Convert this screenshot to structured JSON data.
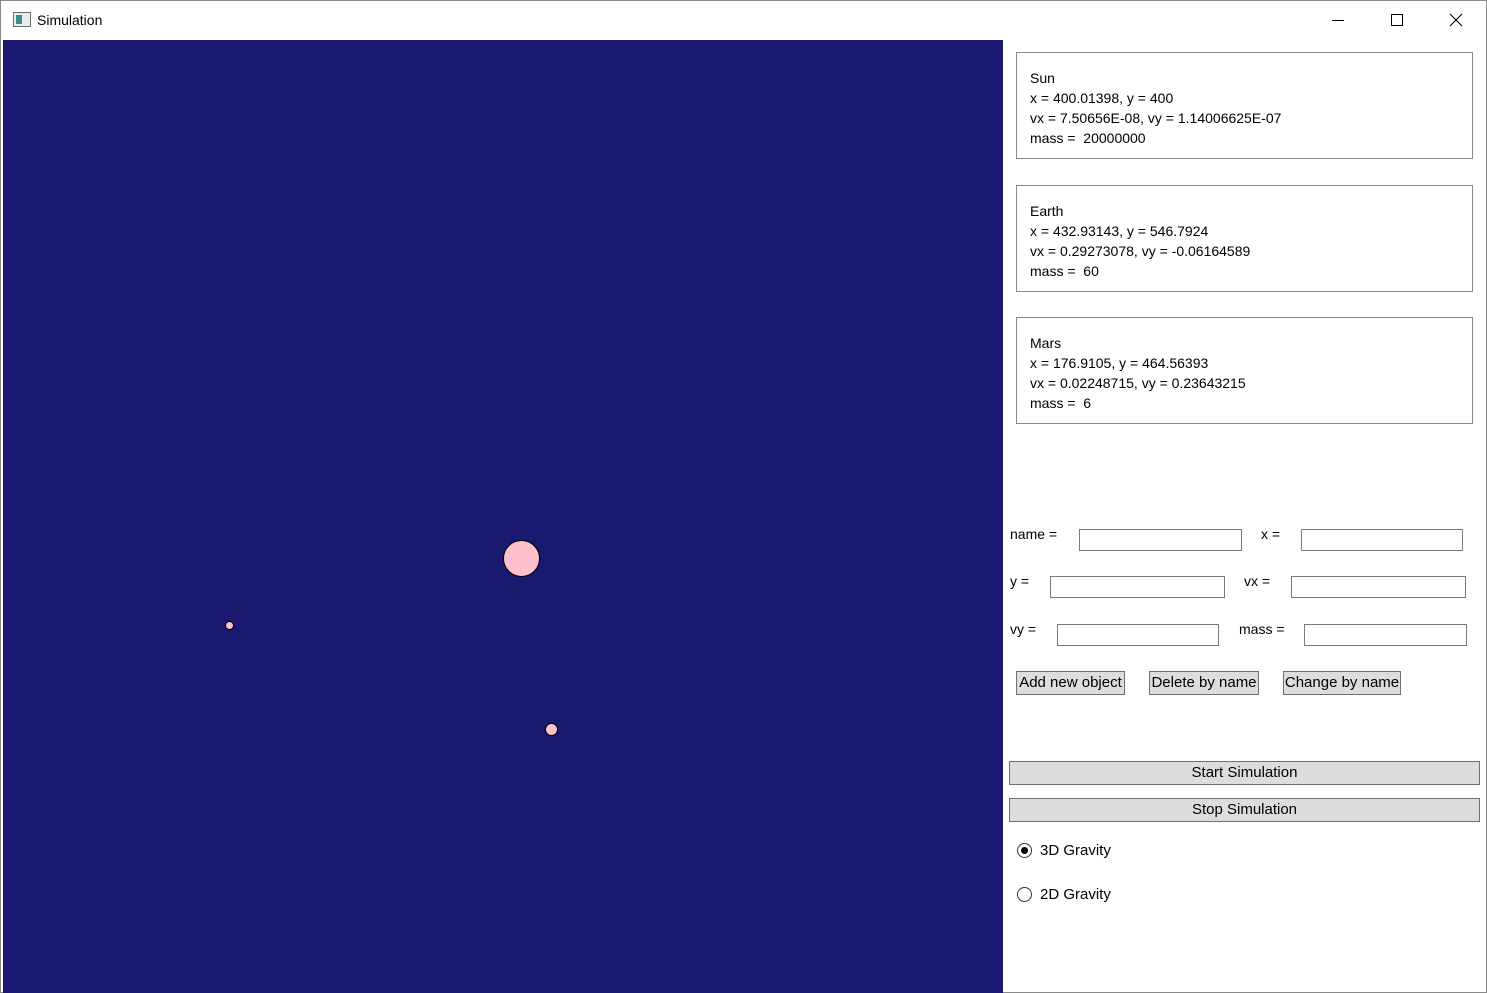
{
  "window": {
    "title": "Simulation"
  },
  "canvas": {
    "background": "#191970",
    "body_color": "#ffc0cb"
  },
  "bodies": [
    {
      "name": "Sun",
      "pos": "x = 400.01398, y = 400",
      "vel": "vx = 7.50656E-08, vy = 1.14006625E-07",
      "mass": "mass =  20000000"
    },
    {
      "name": "Earth",
      "pos": "x = 432.93143, y = 546.7924",
      "vel": "vx = 0.29273078, vy = -0.06164589",
      "mass": "mass =  60"
    },
    {
      "name": "Mars",
      "pos": "x = 176.9105, y = 464.56393",
      "vel": "vx = 0.02248715, vy = 0.23643215",
      "mass": "mass =  6"
    }
  ],
  "form": {
    "name_label": "name =",
    "x_label": "x =",
    "y_label": "y =",
    "vx_label": "vx =",
    "vy_label": "vy =",
    "mass_label": "mass =",
    "name_value": "",
    "x_value": "",
    "y_value": "",
    "vx_value": "",
    "vy_value": "",
    "mass_value": ""
  },
  "buttons": {
    "add": "Add new object",
    "delete": "Delete by name",
    "change": "Change by name",
    "start": "Start Simulation",
    "stop": "Stop Simulation"
  },
  "gravity": {
    "options": [
      "3D Gravity",
      "2D Gravity"
    ],
    "selected": "3D Gravity"
  }
}
